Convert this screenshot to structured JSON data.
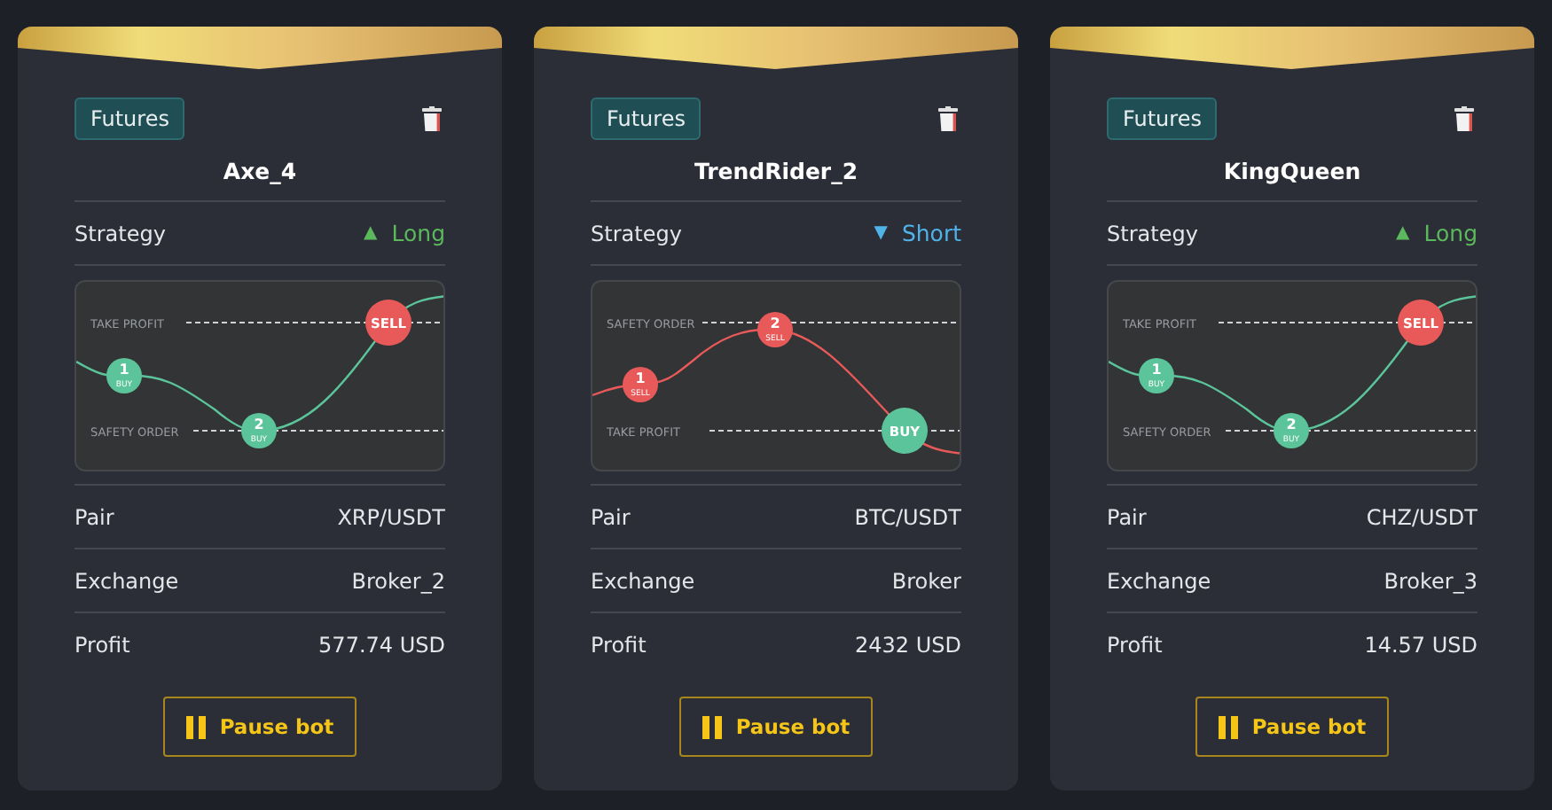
{
  "cards": [
    {
      "tag": "Futures",
      "name": "Axe_4",
      "strategy_label": "Strategy",
      "kind": "long",
      "direction_icon": "▲",
      "direction_text": "Long",
      "chart": {
        "kind": "long",
        "top_line": "TAKE PROFIT",
        "bottom_line": "SAFETY ORDER",
        "markers": [
          {
            "number": "1",
            "label": "BUY",
            "kind": "buy"
          },
          {
            "number": "2",
            "label": "BUY",
            "kind": "buy"
          },
          {
            "label": "SELL",
            "kind": "sell"
          }
        ]
      },
      "rows": [
        {
          "label": "Pair",
          "value": "XRP/USDT"
        },
        {
          "label": "Exchange",
          "value": "Broker_2"
        },
        {
          "label": "Profit",
          "value": "577.74 USD"
        }
      ],
      "button": "Pause bot"
    },
    {
      "tag": "Futures",
      "name": "TrendRider_2",
      "strategy_label": "Strategy",
      "kind": "short",
      "direction_icon": "▼",
      "direction_text": "Short",
      "chart": {
        "kind": "short",
        "top_line": "SAFETY ORDER",
        "bottom_line": "TAKE PROFIT",
        "markers": [
          {
            "number": "1",
            "label": "SELL",
            "kind": "sell"
          },
          {
            "number": "2",
            "label": "SELL",
            "kind": "sell"
          },
          {
            "label": "BUY",
            "kind": "buy"
          }
        ]
      },
      "rows": [
        {
          "label": "Pair",
          "value": "BTC/USDT"
        },
        {
          "label": "Exchange",
          "value": "Broker"
        },
        {
          "label": "Profit",
          "value": "2432 USD"
        }
      ],
      "button": "Pause bot"
    },
    {
      "tag": "Futures",
      "name": "KingQueen",
      "strategy_label": "Strategy",
      "kind": "long",
      "direction_icon": "▲",
      "direction_text": "Long",
      "chart": {
        "kind": "long",
        "top_line": "TAKE PROFIT",
        "bottom_line": "SAFETY ORDER",
        "markers": [
          {
            "number": "1",
            "label": "BUY",
            "kind": "buy"
          },
          {
            "number": "2",
            "label": "BUY",
            "kind": "buy"
          },
          {
            "label": "SELL",
            "kind": "sell"
          }
        ]
      },
      "rows": [
        {
          "label": "Pair",
          "value": "CHZ/USDT"
        },
        {
          "label": "Exchange",
          "value": "Broker_3"
        },
        {
          "label": "Profit",
          "value": "14.57 USD"
        }
      ],
      "button": "Pause bot"
    }
  ]
}
